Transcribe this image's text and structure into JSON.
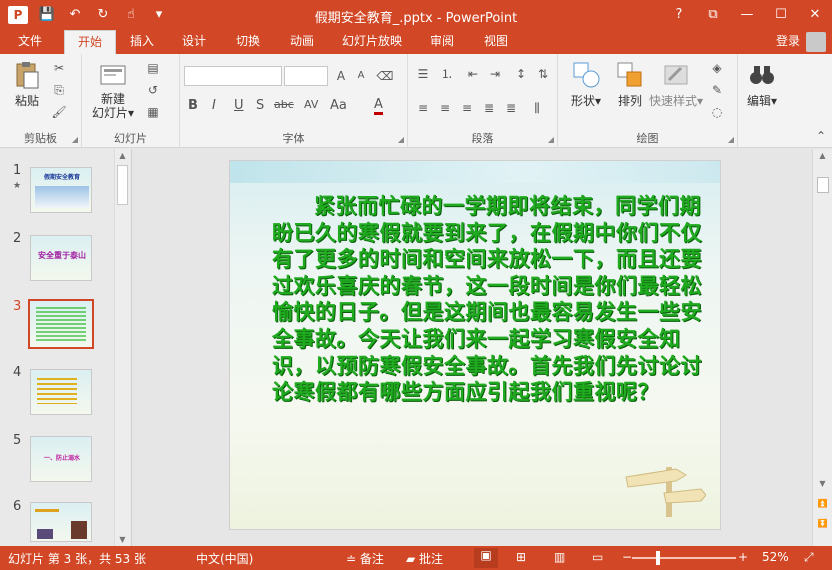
{
  "titlebar": {
    "app_icon": "P",
    "title": "假期安全教育_.pptx - PowerPoint",
    "qat_icons": [
      "save-icon",
      "undo-icon",
      "redo-icon",
      "touch-mode-icon",
      "customize-qat-icon"
    ],
    "window_buttons": {
      "help": "?",
      "restore_ribbon": "⧉",
      "minimize": "—",
      "maximize": "☐",
      "close": "✕"
    }
  },
  "tabs": {
    "file": "文件",
    "home": "开始",
    "insert": "插入",
    "design": "设计",
    "transitions": "切换",
    "animations": "动画",
    "slideshow": "幻灯片放映",
    "review": "审阅",
    "view": "视图",
    "login": "登录"
  },
  "ribbon": {
    "clipboard": {
      "label": "剪贴板",
      "paste": "粘贴"
    },
    "slides": {
      "label": "幻灯片",
      "new_slide_1": "新建",
      "new_slide_2": "幻灯片"
    },
    "font": {
      "label": "字体",
      "bold": "B",
      "italic": "I",
      "underline": "U",
      "strike": "S",
      "shadow_text": "abc",
      "spacing": "AV",
      "case": "Aa",
      "color": "A",
      "grow": "A",
      "shrink": "A"
    },
    "paragraph": {
      "label": "段落"
    },
    "drawing": {
      "label": "绘图",
      "shapes": "形状",
      "arrange": "排列",
      "quick_styles": "快速样式"
    },
    "editing": {
      "label": "编辑"
    }
  },
  "thumbnails": [
    {
      "number": "1",
      "star": "★",
      "caption": "假期安全教育"
    },
    {
      "number": "2",
      "caption": "安全重于泰山"
    },
    {
      "number": "3"
    },
    {
      "number": "4"
    },
    {
      "number": "5",
      "caption": "一、防止溺水"
    },
    {
      "number": "6"
    }
  ],
  "slide": {
    "text": "紧张而忙碌的一学期即将结束，同学们期盼已久的寒假就要到来了，在假期中你们不仅有了更多的时间和空间来放松一下，而且还要过欢乐喜庆的春节，这一段时间是你们最轻松愉快的日子。但是这期间也最容易发生一些安全事故。今天让我们来一起学习寒假安全知识，以预防寒假安全事故。首先我们先讨论讨论寒假都有哪些方面应引起我们重视呢？"
  },
  "statusbar": {
    "slide_info": "幻灯片 第 3 张，共 53 张",
    "language": "中文(中国)",
    "notes": "备注",
    "comments": "批注",
    "zoom_minus": "−",
    "zoom_plus": "+",
    "zoom_level": "52%",
    "zoom_fraction": 0.52
  },
  "colors": {
    "accent": "#d24726",
    "slide_text": "#1faa1f"
  }
}
